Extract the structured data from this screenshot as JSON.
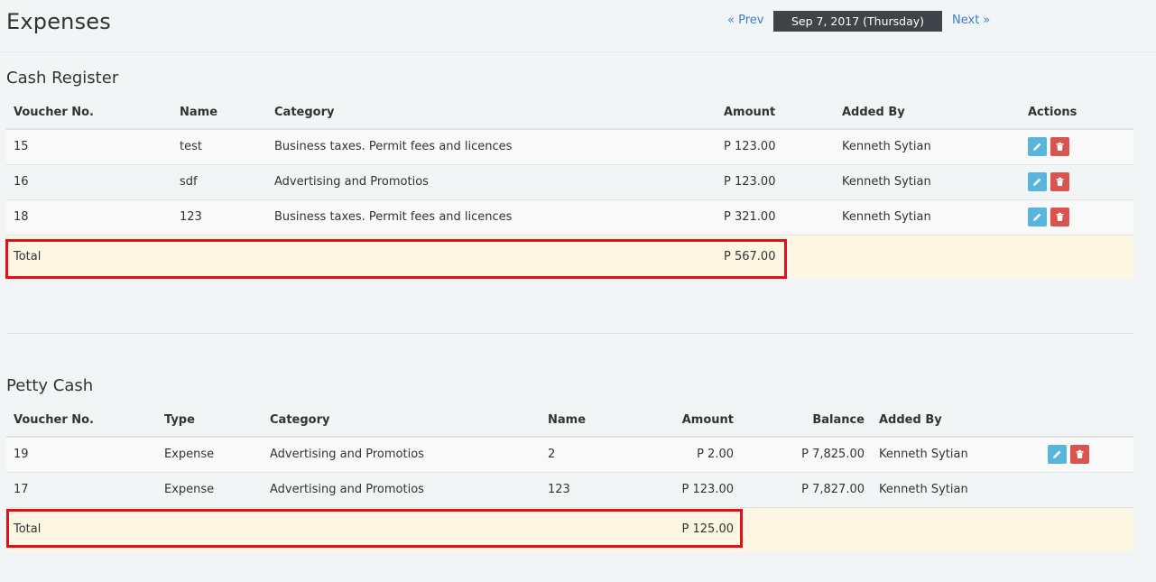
{
  "page": {
    "title": "Expenses"
  },
  "datenav": {
    "prev": "« Prev",
    "date": "Sep 7, 2017 (Thursday)",
    "next": "Next »"
  },
  "cash_register": {
    "title": "Cash Register",
    "headers": [
      "Voucher No.",
      "Name",
      "Category",
      "Amount",
      "Added By",
      "Actions"
    ],
    "rows": [
      {
        "voucher": "15",
        "name": "test",
        "category": "Business taxes. Permit fees and licences",
        "amount": "P 123.00",
        "added_by": "Kenneth Sytian"
      },
      {
        "voucher": "16",
        "name": "sdf",
        "category": "Advertising and Promotios",
        "amount": "P 123.00",
        "added_by": "Kenneth Sytian"
      },
      {
        "voucher": "18",
        "name": "123",
        "category": "Business taxes. Permit fees and licences",
        "amount": "P 321.00",
        "added_by": "Kenneth Sytian"
      }
    ],
    "total_label": "Total",
    "total_amount": "P 567.00"
  },
  "petty_cash": {
    "title": "Petty Cash",
    "headers": [
      "Voucher No.",
      "Type",
      "Category",
      "Name",
      "Amount",
      "Balance",
      "Added By"
    ],
    "rows": [
      {
        "voucher": "19",
        "type": "Expense",
        "category": "Advertising and Promotios",
        "name": "2",
        "amount": "P 2.00",
        "balance": "P 7,825.00",
        "added_by": "Kenneth Sytian",
        "actions": true
      },
      {
        "voucher": "17",
        "type": "Expense",
        "category": "Advertising and Promotios",
        "name": "123",
        "amount": "P 123.00",
        "balance": "P 7,827.00",
        "added_by": "Kenneth Sytian",
        "actions": false
      }
    ],
    "total_label": "Total",
    "total_amount": "P 125.00"
  },
  "icons": {
    "edit": "pencil-icon",
    "delete": "trash-icon"
  },
  "colors": {
    "edit_button": "#57b5de",
    "delete_button": "#d9534f",
    "highlight": "#e0101a",
    "total_row": "#fcf6e3",
    "date_box": "#3f4448"
  }
}
